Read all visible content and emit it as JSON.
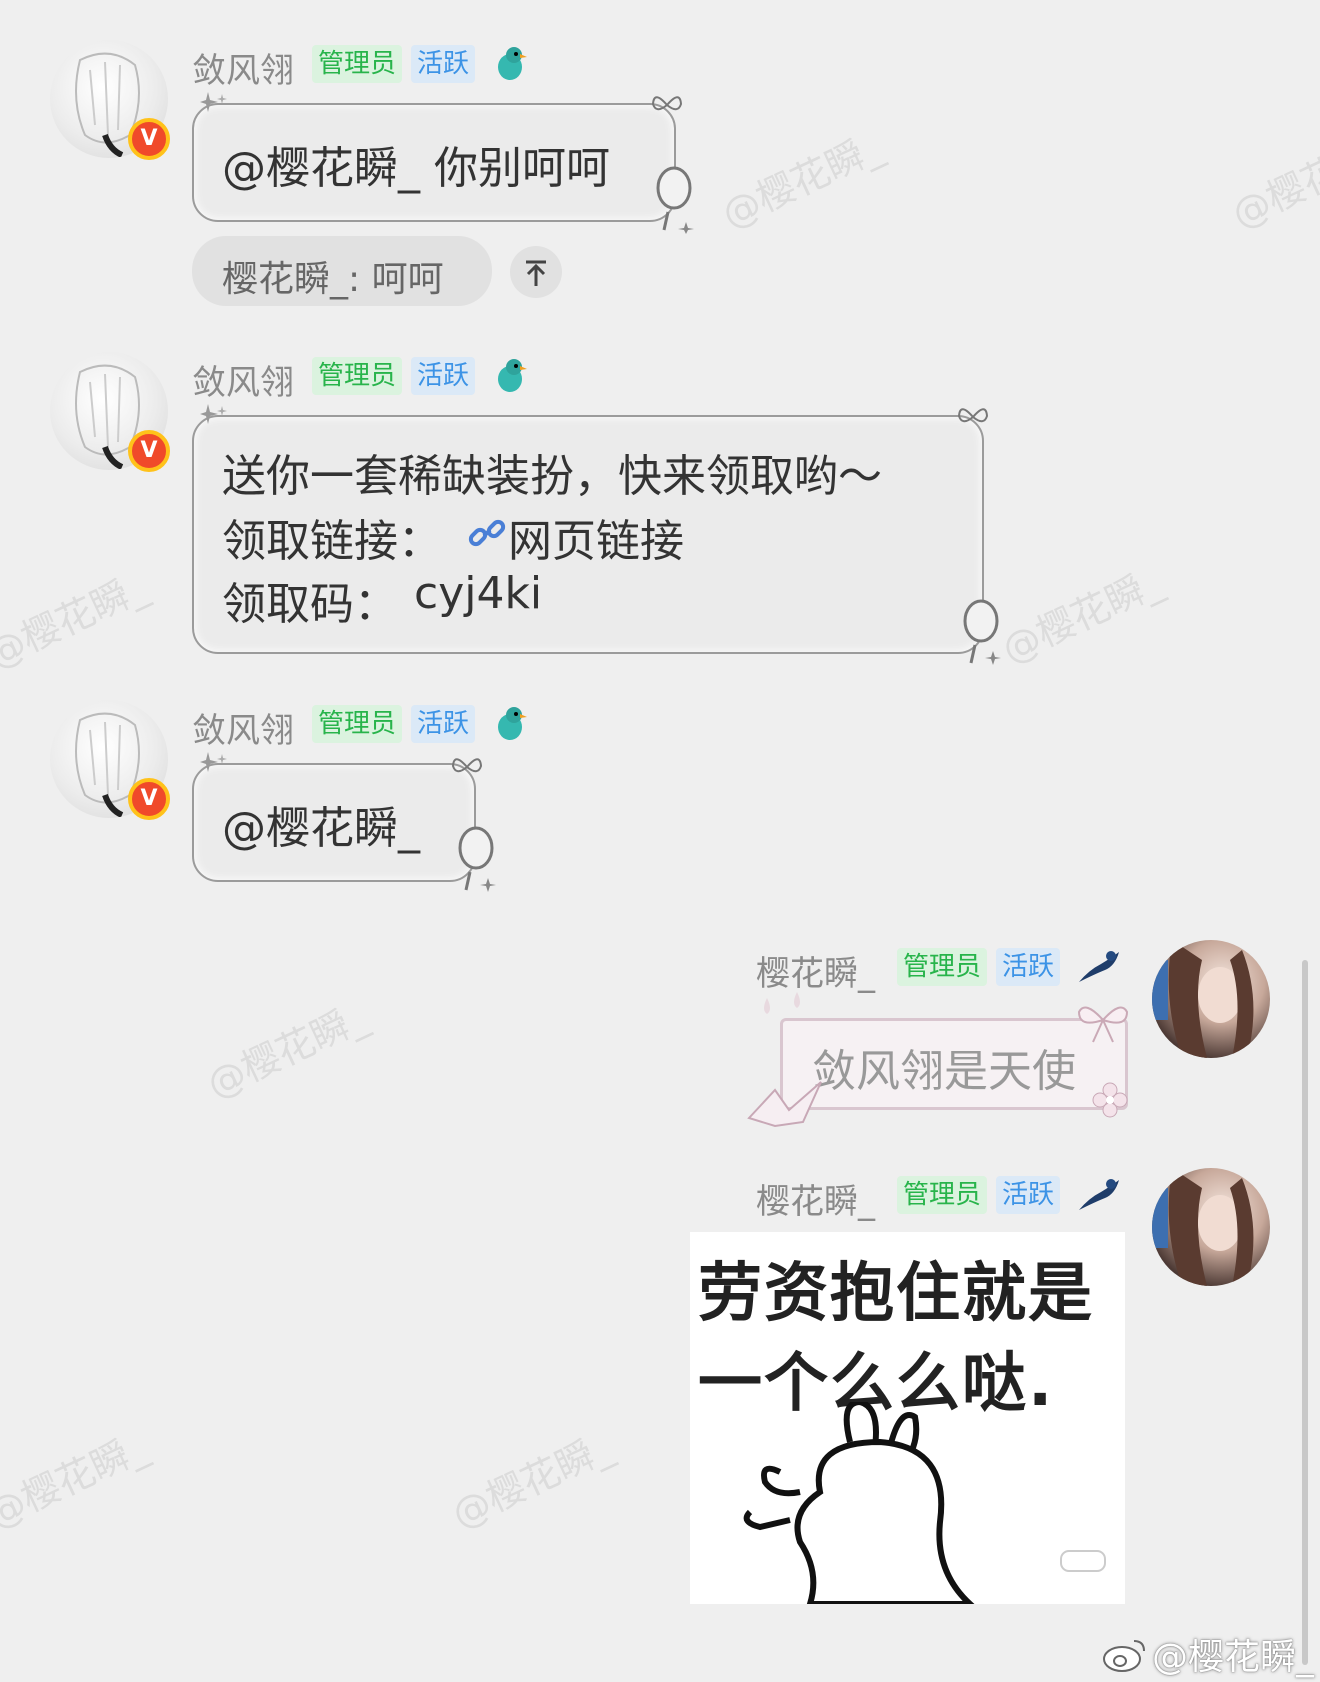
{
  "watermark_text": "@樱花瞬_",
  "messages": [
    {
      "sender": "敛风翎",
      "tags": {
        "admin": "管理员",
        "active": "活跃"
      },
      "verified_badge": "V",
      "text": "@樱花瞬_ 你别呵呵",
      "quoted_reply": "樱花瞬_: 呵呵"
    },
    {
      "sender": "敛风翎",
      "tags": {
        "admin": "管理员",
        "active": "活跃"
      },
      "verified_badge": "V",
      "line1": "送你一套稀缺装扮，快来领取哟～",
      "line2_label": "领取链接：",
      "link_text": "网页链接",
      "line3_label": "领取码：",
      "code": "cyj4ki"
    },
    {
      "sender": "敛风翎",
      "tags": {
        "admin": "管理员",
        "active": "活跃"
      },
      "verified_badge": "V",
      "text": "@樱花瞬_"
    },
    {
      "sender": "樱花瞬_",
      "tags": {
        "admin": "管理员",
        "active": "活跃"
      },
      "text": "敛风翎是天使"
    },
    {
      "sender": "樱花瞬_",
      "tags": {
        "admin": "管理员",
        "active": "活跃"
      },
      "sticker_line1": "劳资抱住就是",
      "sticker_line2": "一个么么哒."
    }
  ],
  "footer": {
    "handle": "@樱花瞬_"
  },
  "colors": {
    "admin_tag": "#28b44b",
    "active_tag": "#3c93e6",
    "link": "#4a7fd6",
    "verified": "#f04a2a"
  }
}
